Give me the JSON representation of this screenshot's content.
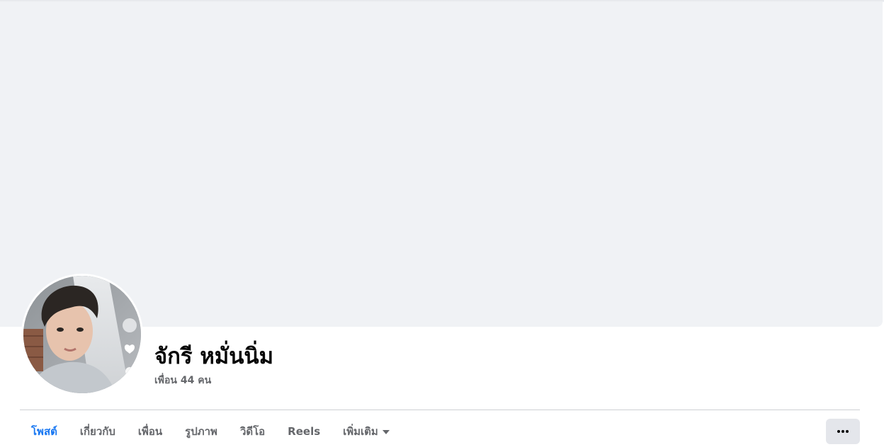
{
  "profile": {
    "name": "จักรี หมั่นนิ่ม",
    "friends_count": "เพื่อน 44 คน"
  },
  "tabs": [
    {
      "label": "โพสต์",
      "active": true
    },
    {
      "label": "เกี่ยวกับ",
      "active": false
    },
    {
      "label": "เพื่อน",
      "active": false
    },
    {
      "label": "รูปภาพ",
      "active": false
    },
    {
      "label": "วิดีโอ",
      "active": false
    },
    {
      "label": "Reels",
      "active": false
    },
    {
      "label": "เพิ่มเติม",
      "active": false
    }
  ],
  "more_button": {
    "icon": "more-horizontal-icon"
  },
  "colors": {
    "accent": "#1877f2",
    "cover_background": "#f0f2f5",
    "text_secondary": "#65676b"
  }
}
